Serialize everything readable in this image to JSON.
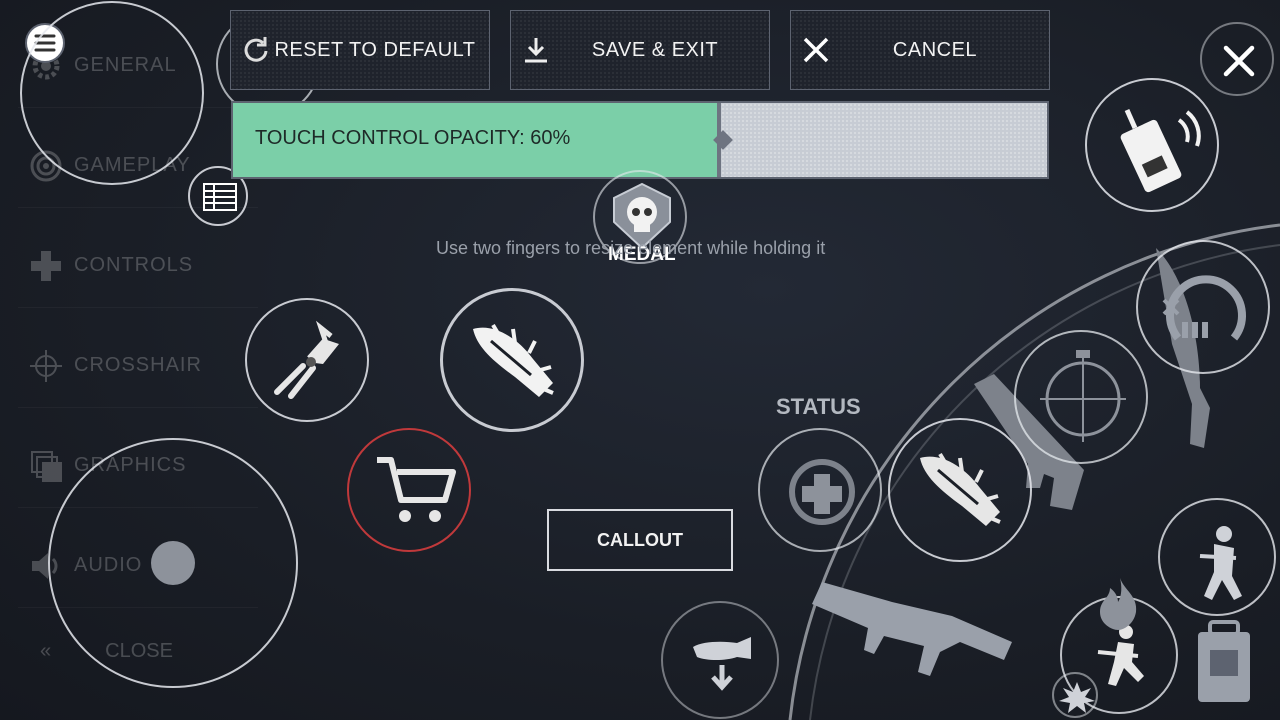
{
  "sidebar": {
    "items": [
      {
        "label": "GENERAL",
        "icon": "gear-icon"
      },
      {
        "label": "GAMEPLAY",
        "icon": "target-icon"
      },
      {
        "label": "CONTROLS",
        "icon": "dpad-icon"
      },
      {
        "label": "CROSSHAIR",
        "icon": "crosshair-icon"
      },
      {
        "label": "GRAPHICS",
        "icon": "layers-icon"
      },
      {
        "label": "AUDIO",
        "icon": "speaker-icon"
      }
    ],
    "close_label": "CLOSE",
    "close_icon": "double-chevron-left-icon"
  },
  "toolbar": {
    "reset_label": "RESET TO DEFAULT",
    "save_label": "SAVE & EXIT",
    "cancel_label": "CANCEL"
  },
  "opacity": {
    "label": "TOUCH CONTROL OPACITY: 60%",
    "value": 0.6,
    "fill_color": "#7bcfa8"
  },
  "hint": "Use two fingers to resize element while holding it",
  "hud": {
    "medal_label": "MEDAL",
    "status_label": "STATUS",
    "callout_label": "CALLOUT"
  },
  "colors": {
    "background": "#1b1f27",
    "button_border": "#5d6370",
    "shop_ring": "#c0393b"
  }
}
